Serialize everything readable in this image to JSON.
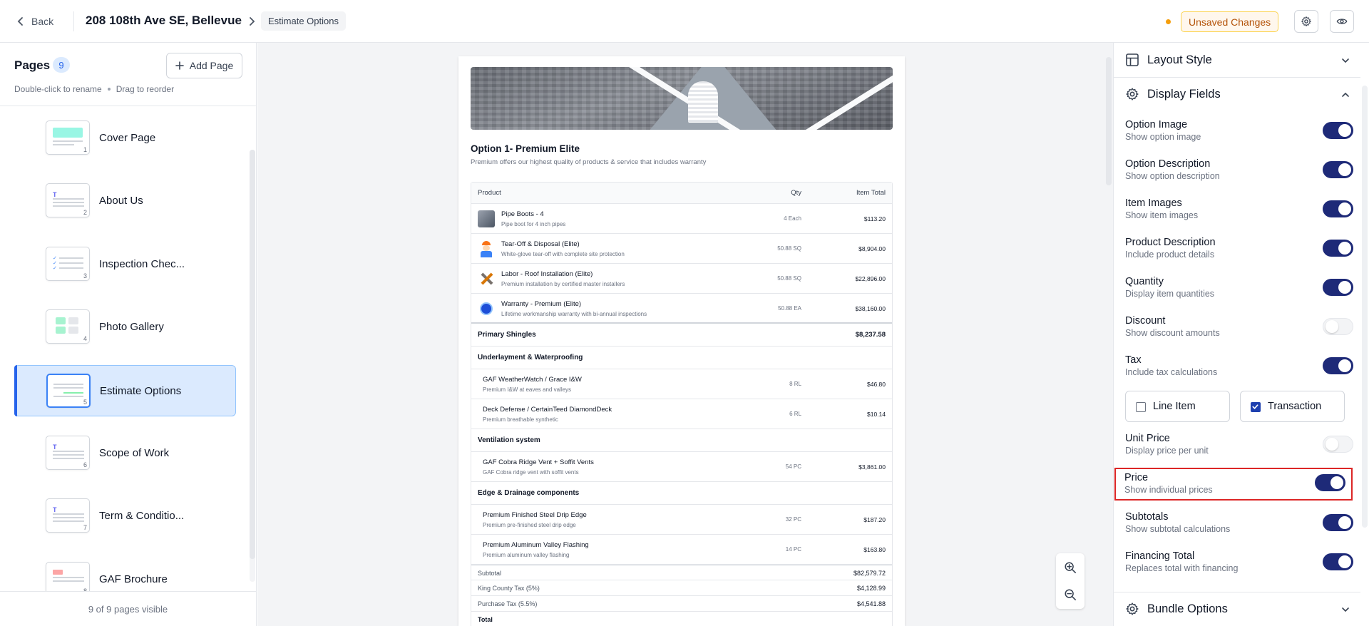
{
  "topbar": {
    "back_label": "Back",
    "address": "208 108th Ave SE, Bellevue",
    "breadcrumb": "Estimate Options",
    "unsaved_label": "Unsaved Changes",
    "accent_color": "#f59e0b"
  },
  "sidebar": {
    "title": "Pages",
    "count": "9",
    "add_page_label": "Add Page",
    "hint_rename": "Double-click to rename",
    "hint_reorder": "Drag to reorder",
    "visible_footer": "9 of 9 pages visible",
    "pages": [
      {
        "num": "1",
        "label": "Cover Page",
        "thumb": "cover"
      },
      {
        "num": "2",
        "label": "About Us",
        "thumb": "text"
      },
      {
        "num": "3",
        "label": "Inspection Chec...",
        "thumb": "checklist"
      },
      {
        "num": "4",
        "label": "Photo Gallery",
        "thumb": "gallery"
      },
      {
        "num": "5",
        "label": "Estimate Options",
        "thumb": "estimate",
        "active": true
      },
      {
        "num": "6",
        "label": "Scope of Work",
        "thumb": "text"
      },
      {
        "num": "7",
        "label": "Term & Conditio...",
        "thumb": "text"
      },
      {
        "num": "8",
        "label": "GAF Brochure",
        "thumb": "pdf"
      }
    ]
  },
  "document": {
    "option_title": "Option 1- Premium Elite",
    "option_subtitle": "Premium offers our highest quality of products & service that includes warranty",
    "columns": {
      "product": "Product",
      "qty": "Qty",
      "total": "Item Total"
    },
    "items": [
      {
        "name": "Pipe Boots - 4",
        "desc": "Pipe boot for 4 inch pipes",
        "qty": "4 Each",
        "total": "$113.20",
        "icon": "pipe-boot"
      },
      {
        "name": "Tear-Off & Disposal (Elite)",
        "desc": "White-glove tear-off with complete site protection",
        "qty": "50.88 SQ",
        "total": "$8,904.00",
        "icon": "worker"
      },
      {
        "name": "Labor - Roof Installation (Elite)",
        "desc": "Premium installation by certified master installers",
        "qty": "50.88 SQ",
        "total": "$22,896.00",
        "icon": "tools"
      },
      {
        "name": "Warranty - Premium (Elite)",
        "desc": "Lifetime workmanship warranty with bi-annual inspections",
        "qty": "50.88 EA",
        "total": "$38,160.00",
        "icon": "badge"
      }
    ],
    "groups": [
      {
        "name": "Primary Shingles",
        "total": "$8,237.58",
        "rows": []
      },
      {
        "name": "Underlayment & Waterproofing",
        "total": "",
        "rows": [
          {
            "name": "GAF WeatherWatch / Grace I&W",
            "desc": "Premium I&W at eaves and valleys",
            "qty": "8 RL",
            "total": "$46.80"
          },
          {
            "name": "Deck Defense / CertainTeed DiamondDeck",
            "desc": "Premium breathable synthetic",
            "qty": "6 RL",
            "total": "$10.14"
          }
        ]
      },
      {
        "name": "Ventilation system",
        "total": "",
        "rows": [
          {
            "name": "GAF Cobra Ridge Vent + Soffit Vents",
            "desc": "GAF Cobra ridge vent with soffit vents",
            "qty": "54 PC",
            "total": "$3,861.00"
          }
        ]
      },
      {
        "name": "Edge & Drainage components",
        "total": "",
        "rows": [
          {
            "name": "Premium Finished Steel Drip Edge",
            "desc": "Premium pre-finished steel drip edge",
            "qty": "32 PC",
            "total": "$187.20"
          },
          {
            "name": "Premium Aluminum Valley Flashing",
            "desc": "Premium aluminum valley flashing",
            "qty": "14 PC",
            "total": "$163.80"
          }
        ]
      }
    ],
    "summary": [
      {
        "label": "Subtotal",
        "value": "$82,579.72"
      },
      {
        "label": "King County Tax (5%)",
        "value": "$4,128.99"
      },
      {
        "label": "Purchase Tax (5.5%)",
        "value": "$4,541.88"
      }
    ],
    "total_label": "Total"
  },
  "panel": {
    "layout_style": "Layout Style",
    "display_fields": "Display Fields",
    "bundle_options": "Bundle Options",
    "fields": [
      {
        "label": "Option Image",
        "desc": "Show option image",
        "on": true
      },
      {
        "label": "Option Description",
        "desc": "Show option description",
        "on": true
      },
      {
        "label": "Item Images",
        "desc": "Show item images",
        "on": true
      },
      {
        "label": "Product Description",
        "desc": "Include product details",
        "on": true
      },
      {
        "label": "Quantity",
        "desc": "Display item quantities",
        "on": true
      },
      {
        "label": "Discount",
        "desc": "Show discount amounts",
        "on": false
      },
      {
        "label": "Tax",
        "desc": "Include tax calculations",
        "on": true
      }
    ],
    "tax_modes": {
      "line_item": "Line Item",
      "line_item_checked": false,
      "transaction": "Transaction",
      "transaction_checked": true
    },
    "fields_after": [
      {
        "label": "Unit Price",
        "desc": "Display price per unit",
        "on": false
      },
      {
        "label": "Price",
        "desc": "Show individual prices",
        "on": true,
        "highlight": true
      },
      {
        "label": "Subtotals",
        "desc": "Show subtotal calculations",
        "on": true
      },
      {
        "label": "Financing Total",
        "desc": "Replaces total with financing",
        "on": true
      }
    ],
    "toggle_on_color": "#1e2a78",
    "highlight_color": "#dc2626"
  }
}
